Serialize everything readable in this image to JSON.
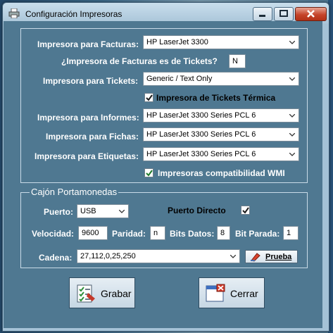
{
  "window": {
    "title": "Configuración Impresoras"
  },
  "printers": {
    "facturas": {
      "label": "Impresora para Facturas:",
      "value": "HP LaserJet 3300"
    },
    "facturas_tickets": {
      "label": "¿Impresora de Facturas es de Tickets?",
      "value": "N"
    },
    "tickets": {
      "label": "Impresora para Tickets:",
      "value": "Generic / Text Only"
    },
    "tickets_termica": {
      "label": "Impresora de Tickets Térmica",
      "checked": true
    },
    "informes": {
      "label": "Impresora para Informes:",
      "value": "HP LaserJet 3300 Series PCL 6"
    },
    "fichas": {
      "label": "Impresora para Fichas:",
      "value": "HP LaserJet 3300 Series PCL 6"
    },
    "etiquetas": {
      "label": "Impresora para Etiquetas:",
      "value": "HP LaserJet 3300 Series PCL 6"
    },
    "wmi": {
      "label": "Impresoras compatibilidad WMI",
      "checked": true
    }
  },
  "cajon": {
    "legend": "Cajón Portamonedas",
    "puerto": {
      "label": "Puerto:",
      "value": "USB"
    },
    "puerto_directo": {
      "label": "Puerto Directo",
      "checked": true
    },
    "velocidad": {
      "label": "Velocidad:",
      "value": "9600"
    },
    "paridad": {
      "label": "Paridad:",
      "value": "n"
    },
    "bits_datos": {
      "label": "Bits Datos:",
      "value": "8"
    },
    "bit_parada": {
      "label": "Bit Parada:",
      "value": "1"
    },
    "cadena": {
      "label": "Cadena:",
      "value": "27,112,0,25,250"
    },
    "prueba_label": "Prueba"
  },
  "buttons": {
    "grabar": "Grabar",
    "cerrar": "Cerrar"
  },
  "icons": {
    "printer": "printer-icon",
    "save": "save-checklist-icon",
    "close": "close-window-icon",
    "test": "pencil-eraser-icon"
  },
  "colors": {
    "client_bg": "#4f7891",
    "titlebar": "#b9d2e4",
    "close_button": "#c5442a",
    "label_text": "#ffffff"
  }
}
